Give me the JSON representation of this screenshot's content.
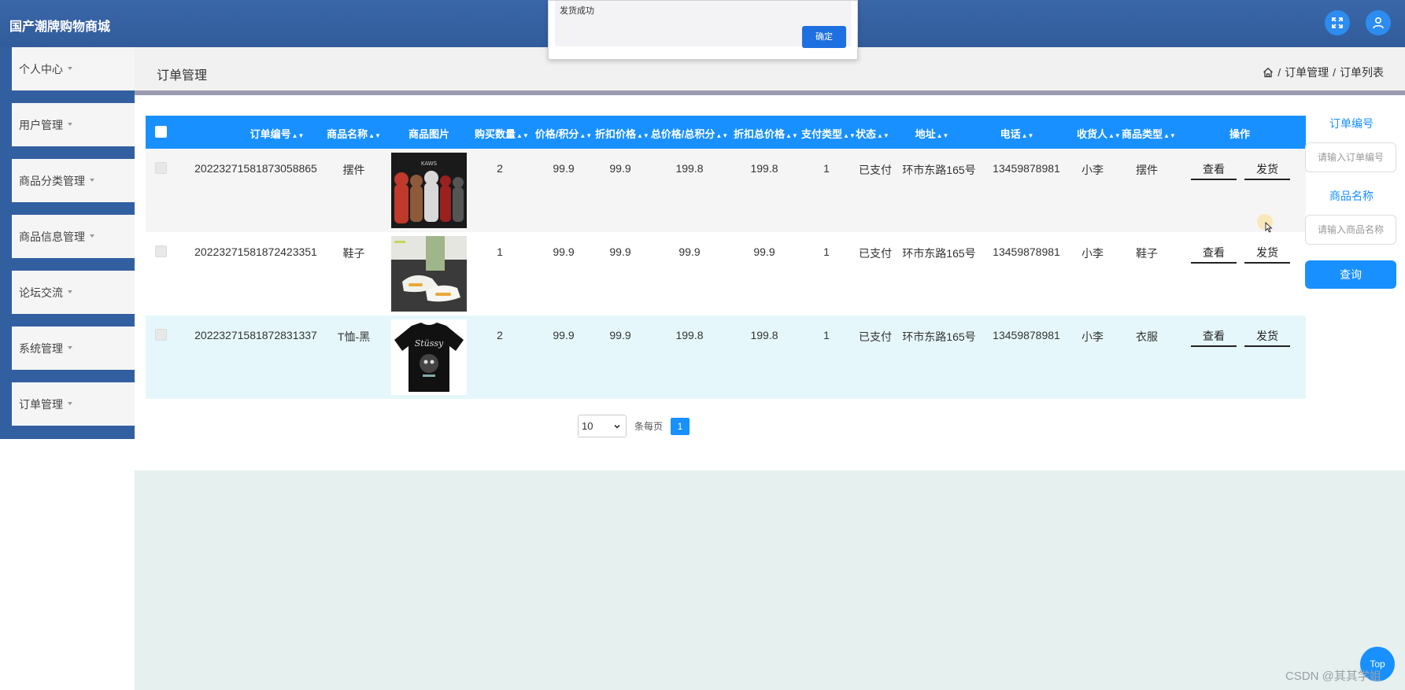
{
  "header": {
    "app_title": "国产潮牌购物商城"
  },
  "sidebar": {
    "items": [
      {
        "label": "个人中心"
      },
      {
        "label": "用户管理"
      },
      {
        "label": "商品分类管理"
      },
      {
        "label": "商品信息管理"
      },
      {
        "label": "论坛交流"
      },
      {
        "label": "系统管理"
      },
      {
        "label": "订单管理"
      }
    ]
  },
  "page": {
    "title": "订单管理",
    "breadcrumb": {
      "sep1": "/",
      "item1": "订单管理",
      "sep2": "/",
      "item2": "订单列表"
    }
  },
  "alert": {
    "message": "发货成功",
    "ok_label": "确定"
  },
  "table": {
    "headers": {
      "order_no": "订单编号",
      "name": "商品名称",
      "image": "商品图片",
      "qty": "购买数量",
      "price": "价格/积分",
      "disc_price": "折扣价格",
      "total": "总价格/总积分",
      "disc_total": "折扣总价格",
      "pay_type": "支付类型",
      "status": "状态",
      "address": "地址",
      "phone": "电话",
      "receiver": "收货人",
      "category": "商品类型",
      "ops": "操作"
    },
    "rows": [
      {
        "order_no": "20223271581873058865",
        "name": "摆件",
        "qty": "2",
        "price": "99.9",
        "disc_price": "99.9",
        "total": "199.8",
        "disc_total": "199.8",
        "pay_type": "1",
        "status": "已支付",
        "address": "环市东路165号",
        "phone": "13459878981",
        "receiver": "小李",
        "category": "摆件",
        "view_label": "查看",
        "ship_label": "发货"
      },
      {
        "order_no": "20223271581872423351",
        "name": "鞋子",
        "qty": "1",
        "price": "99.9",
        "disc_price": "99.9",
        "total": "99.9",
        "disc_total": "99.9",
        "pay_type": "1",
        "status": "已支付",
        "address": "环市东路165号",
        "phone": "13459878981",
        "receiver": "小李",
        "category": "鞋子",
        "view_label": "查看",
        "ship_label": "发货"
      },
      {
        "order_no": "20223271581872831337",
        "name": "T恤-黑",
        "qty": "2",
        "price": "99.9",
        "disc_price": "99.9",
        "total": "199.8",
        "disc_total": "199.8",
        "pay_type": "1",
        "status": "已支付",
        "address": "环市东路165号",
        "phone": "13459878981",
        "receiver": "小李",
        "category": "衣服",
        "view_label": "查看",
        "ship_label": "发货"
      }
    ]
  },
  "pagination": {
    "page_size": "10",
    "per_page_label": "条每页",
    "current_page": "1"
  },
  "search": {
    "order_no_label": "订单编号",
    "order_no_placeholder": "请输入订单编号",
    "name_label": "商品名称",
    "name_placeholder": "请输入商品名称",
    "submit_label": "查询"
  },
  "top_button": "Top",
  "watermark": "CSDN @其其学姐",
  "colors": {
    "header": "#315c9c",
    "accent": "#1890ff",
    "sidebar_bg": "#325fa0"
  }
}
